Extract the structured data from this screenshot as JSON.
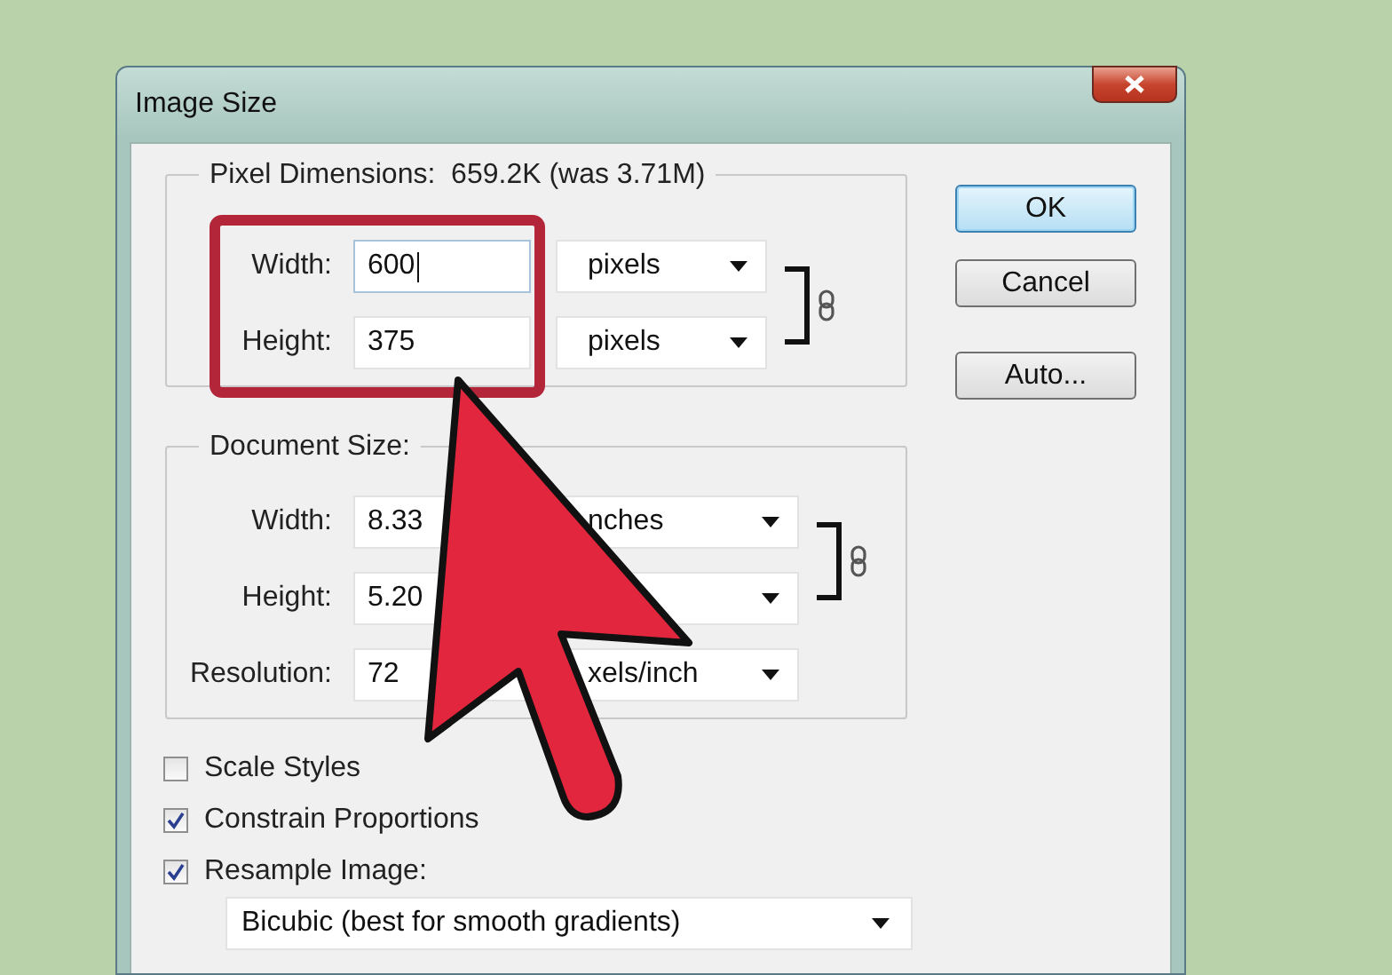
{
  "window": {
    "title": "Image Size"
  },
  "pixel_dimensions": {
    "legend": "Pixel Dimensions:",
    "value": "659.2K (was 3.71M)",
    "highlighted": true,
    "rows": [
      {
        "label": "Width:",
        "value": "600",
        "focused": true,
        "unit": "pixels"
      },
      {
        "label": "Height:",
        "value": "375",
        "focused": false,
        "unit": "pixels"
      }
    ]
  },
  "document_size": {
    "legend": "Document Size:",
    "rows": [
      {
        "label": "Width:",
        "value": "8.33",
        "focused": false,
        "unit": "nches"
      },
      {
        "label": "Height:",
        "value": "5.20",
        "focused": false
      },
      {
        "label": "Resolution:",
        "value": "72",
        "focused": false,
        "unit": "xels/inch"
      }
    ]
  },
  "options": [
    {
      "label": "Scale Styles",
      "checked": false
    },
    {
      "label": "Constrain Proportions",
      "checked": true
    },
    {
      "label": "Resample Image:",
      "checked": true
    }
  ],
  "resample_method": "Bicubic (best for smooth gradients)",
  "buttons": [
    {
      "label": "OK",
      "default": true
    },
    {
      "label": "Cancel",
      "default": false
    },
    {
      "label": "Auto...",
      "default": false
    }
  ]
}
